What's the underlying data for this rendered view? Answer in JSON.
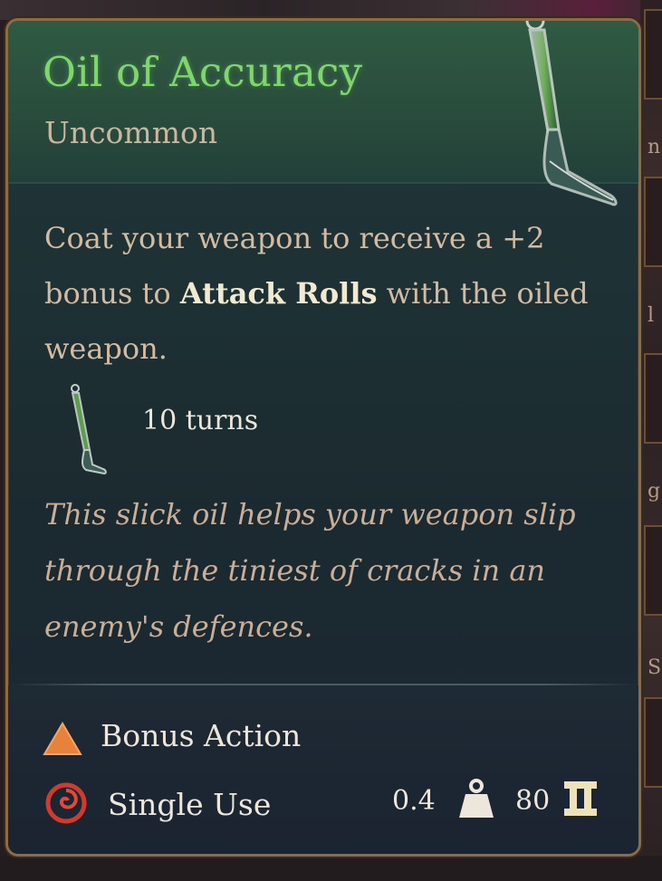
{
  "item": {
    "name": "Oil of Accuracy",
    "rarity": "Uncommon",
    "description_parts": {
      "before": "Coat your weapon to receive a +2 bonus to ",
      "highlight": "Attack Rolls",
      "after": " with the oiled weapon."
    },
    "duration": "10 turns",
    "flavor": "This slick oil helps your weapon slip through the tiniest of cracks in an enemy's defences.",
    "action_type": "Bonus Action",
    "usage": "Single Use",
    "weight": "0.4",
    "value": "80"
  },
  "colors": {
    "title": "#7fd66a",
    "header_bg": "#2f5a43",
    "panel_bg": "#1d3033",
    "border": "#8a6c47",
    "highlight_text": "#f1ead0",
    "bonus_action_icon": "#e8823a",
    "single_use_icon": "#d13a2e"
  },
  "icons": {
    "item": "oil-vial-icon",
    "duration": "oil-vial-icon",
    "action": "triangle-bonus-action-icon",
    "usage": "spiral-single-use-icon",
    "weight": "weight-icon",
    "value": "gold-coin-icon"
  },
  "background": {
    "right_letters": [
      "n",
      "l",
      "g",
      "Se"
    ]
  }
}
